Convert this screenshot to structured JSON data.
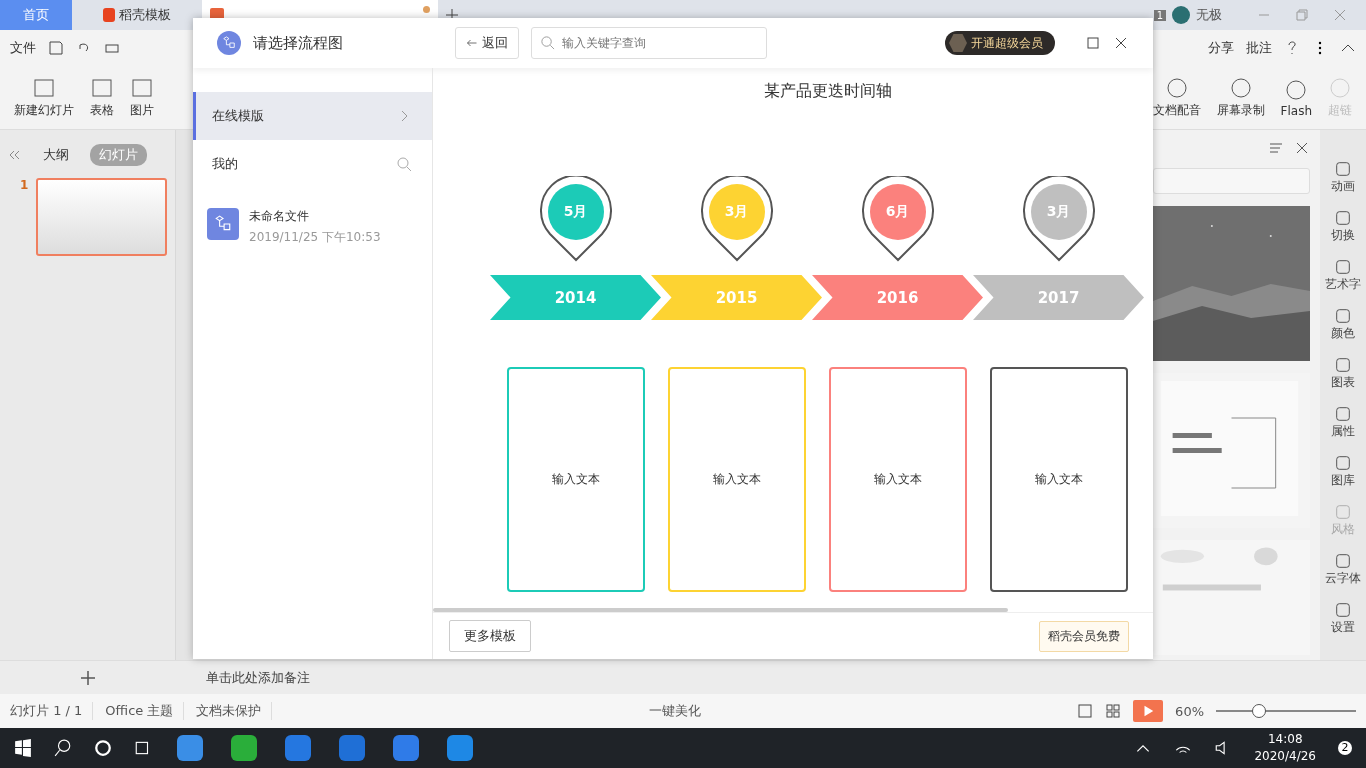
{
  "title_bar": {
    "tabs": [
      {
        "label": "首页",
        "selected": true
      },
      {
        "label": "稻壳模板",
        "selected": false
      }
    ],
    "window_count": "1",
    "user": "无极"
  },
  "toolbar": {
    "menu": "文件",
    "actions": [
      "分享",
      "批注"
    ]
  },
  "ribbon": {
    "left": [
      "新建幻灯片",
      "表格",
      "图片"
    ],
    "right": [
      "文档配音",
      "屏幕录制",
      "Flash",
      "超链"
    ]
  },
  "slide_panel": {
    "tabs": [
      {
        "label": "大纲",
        "selected": false
      },
      {
        "label": "幻灯片",
        "selected": true
      }
    ],
    "slide_number": "1"
  },
  "side_tools": [
    {
      "label": "动画",
      "disabled": false
    },
    {
      "label": "切换",
      "disabled": false
    },
    {
      "label": "艺术字",
      "disabled": false
    },
    {
      "label": "颜色",
      "disabled": false
    },
    {
      "label": "图表",
      "disabled": false
    },
    {
      "label": "属性",
      "disabled": false
    },
    {
      "label": "图库",
      "disabled": false
    },
    {
      "label": "风格",
      "disabled": true
    },
    {
      "label": "云字体",
      "disabled": false
    },
    {
      "label": "设置",
      "disabled": false
    }
  ],
  "notes": {
    "placeholder": "单击此处添加备注"
  },
  "status_bar": {
    "slide": "幻灯片 1 / 1",
    "theme": "Office 主题",
    "protection": "文档未保护",
    "beautify": "一键美化",
    "zoom": "60%",
    "zoom_slider": {
      "level": 0.3
    }
  },
  "taskbar": {
    "time": "14:08",
    "date": "2020/4/26",
    "notifications": "2"
  },
  "dialog": {
    "title": "请选择流程图",
    "back": "返回",
    "search": {
      "placeholder": "输入关键字查询"
    },
    "vip": "开通超级会员",
    "sidebar": [
      {
        "label": "在线模版",
        "selected": true
      },
      {
        "label": "我的",
        "selected": false
      }
    ],
    "file": {
      "name": "未命名文件",
      "date": "2019/11/25 下午10:53"
    },
    "preview": {
      "title": "某产品更迭时间轴",
      "items": [
        {
          "month": "5月",
          "year": "2014",
          "color": "#1ccbb7",
          "card": {
            "text": "输入文本",
            "color": "#1ccbb7"
          }
        },
        {
          "month": "3月",
          "year": "2015",
          "color": "#fdd332",
          "card": {
            "text": "输入文本",
            "color": "#fdd332"
          }
        },
        {
          "month": "6月",
          "year": "2016",
          "color": "#fb817d",
          "card": {
            "text": "输入文本",
            "color": "#fb817d"
          }
        },
        {
          "month": "3月",
          "year": "2017",
          "color": "#bfbfbf",
          "card": {
            "text": "输入文本",
            "color": "#555555"
          }
        }
      ]
    },
    "more": "更多模板",
    "free": "稻壳会员免费"
  }
}
